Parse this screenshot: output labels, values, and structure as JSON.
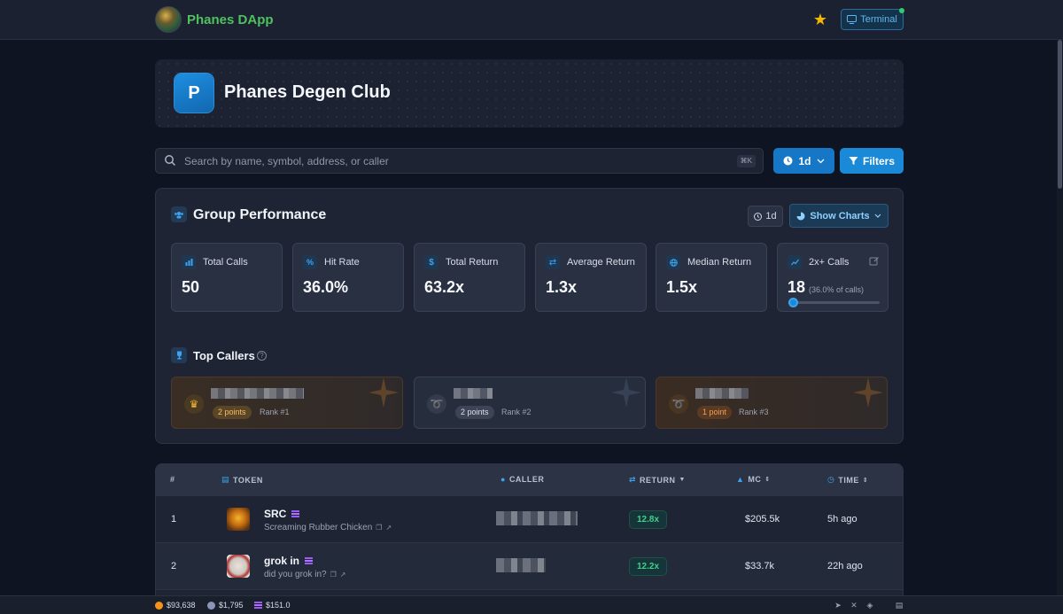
{
  "nav": {
    "brand": "Phanes DApp",
    "terminal_label": "Terminal"
  },
  "club": {
    "avatar_letter": "P",
    "title": "Phanes Degen Club"
  },
  "search": {
    "placeholder": "Search by name, symbol, address, or caller",
    "shortcut": "⌘K"
  },
  "controls": {
    "period": "1d",
    "filters_label": "Filters"
  },
  "performance": {
    "title": "Group Performance",
    "period": "1d",
    "show_charts_label": "Show Charts",
    "stats": [
      {
        "label": "Total Calls",
        "value": "50",
        "icon": "bar-chart-icon"
      },
      {
        "label": "Hit Rate",
        "value": "36.0%",
        "icon": "percent-icon"
      },
      {
        "label": "Total Return",
        "value": "63.2x",
        "icon": "dollar-icon"
      },
      {
        "label": "Average Return",
        "value": "1.3x",
        "icon": "swap-icon"
      },
      {
        "label": "Median Return",
        "value": "1.5x",
        "icon": "globe-icon"
      },
      {
        "label": "2x+ Calls",
        "value": "18",
        "sub": "(36.0% of calls)",
        "icon": "trend-icon",
        "slider_fraction": 0.05
      }
    ]
  },
  "top_callers": {
    "title": "Top Callers",
    "cards": [
      {
        "points": "2 points",
        "rank": "Rank #1",
        "tier": "gold",
        "icon": "crown-icon"
      },
      {
        "points": "2 points",
        "rank": "Rank #2",
        "tier": "silver",
        "icon": "medal-icon"
      },
      {
        "points": "1 point",
        "rank": "Rank #3",
        "tier": "bronze",
        "icon": "medal-icon"
      }
    ]
  },
  "table": {
    "headers": {
      "num": "#",
      "token": "TOKEN",
      "caller": "CALLER",
      "return": "RETURN",
      "mc": "MC",
      "time": "TIME"
    },
    "rows": [
      {
        "num": "1",
        "symbol": "SRC",
        "name": "Screaming Rubber Chicken",
        "return": "12.8x",
        "mc": "$205.5k",
        "time": "5h ago"
      },
      {
        "num": "2",
        "symbol": "grok in",
        "name": "did you grok in?",
        "return": "12.2x",
        "mc": "$33.7k",
        "time": "22h ago"
      }
    ]
  },
  "status": {
    "btc": "$93,638",
    "eth": "$1,795",
    "sol": "$151.0"
  },
  "colors": {
    "accent": "#1a8ad8",
    "brand": "#4fc25f",
    "positive": "#3fd08a",
    "background": "#0f1422"
  }
}
